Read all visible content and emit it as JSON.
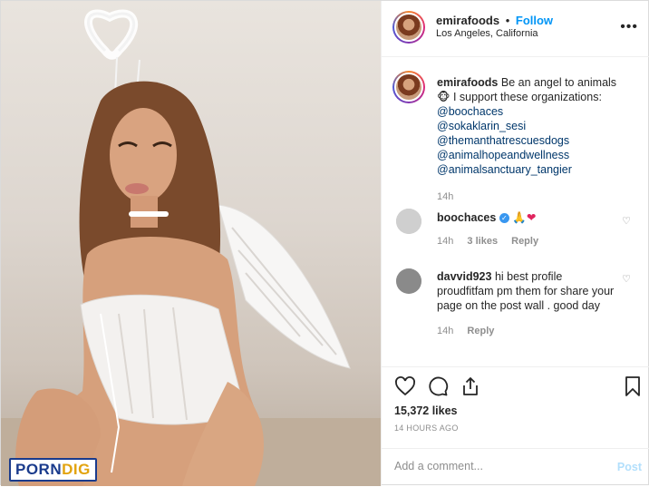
{
  "photo": {
    "alt_subject": "person in angel costume with halo and wings",
    "watermark_part1": "PORN",
    "watermark_part2": "DIG"
  },
  "header": {
    "username": "emirafoods",
    "separator": "•",
    "follow_label": "Follow",
    "location": "Los Angeles, California",
    "more_label": "•••"
  },
  "caption": {
    "username": "emirafoods",
    "text_line1": "Be an angel to animals",
    "emoji": "🐵",
    "text_line2": "I support these organizations:",
    "mentions": [
      "@boochaces",
      "@sokaklarin_sesi",
      "@themanthatrescuesdogs",
      "@animalhopeandwellness",
      "@animalsanctuary_tangier"
    ],
    "time": "14h"
  },
  "comments": [
    {
      "username": "boochaces",
      "text": "🙏❤",
      "time": "14h",
      "likes": "3 likes",
      "reply_label": "Reply"
    },
    {
      "username": "davvid923",
      "text": "hi best profile proudfitfam pm them for share your page on the post wall . good day",
      "time": "14h",
      "reply_label": "Reply"
    }
  ],
  "actions": {
    "likes_count": "15,372 likes",
    "timestamp": "14 HOURS AGO"
  },
  "add_comment": {
    "placeholder": "Add a comment...",
    "post_label": "Post"
  },
  "colors": {
    "accent_blue": "#0095f6",
    "mention_blue": "#00376b",
    "muted": "#8e8e8e",
    "post_disabled": "#b2dffc"
  }
}
